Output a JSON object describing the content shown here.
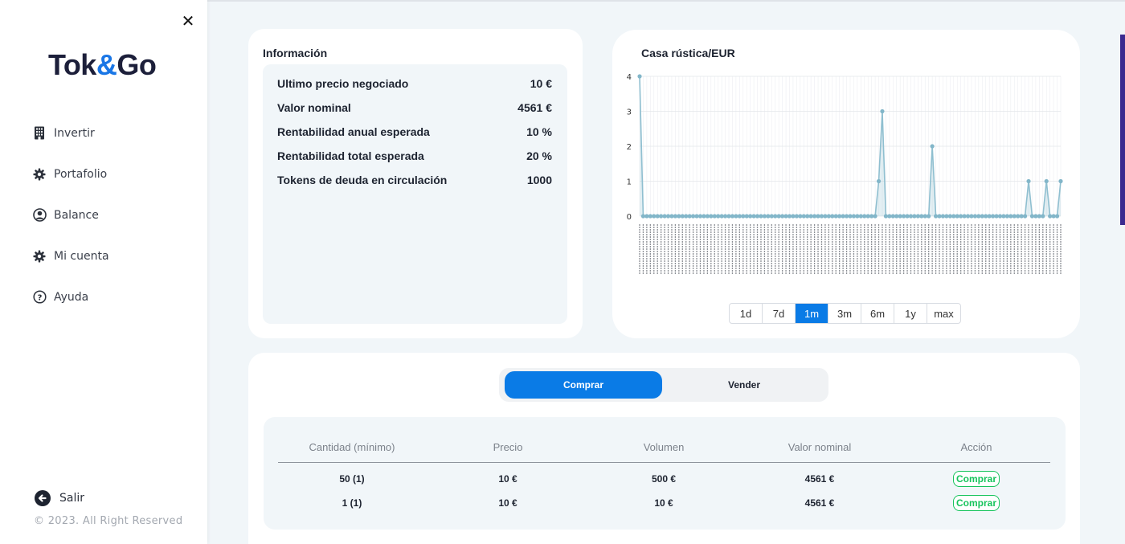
{
  "sidebar": {
    "logo_pre": "Tok",
    "logo_amp": "&",
    "logo_post": "Go",
    "items": [
      {
        "label": "Invertir",
        "icon": "building-icon"
      },
      {
        "label": "Portafolio",
        "icon": "gear-icon"
      },
      {
        "label": "Balance",
        "icon": "user-circle-icon"
      },
      {
        "label": "Mi cuenta",
        "icon": "gear-icon"
      },
      {
        "label": "Ayuda",
        "icon": "help-circle-icon"
      }
    ],
    "logout_label": "Salir",
    "copyright": "© 2023. All Right Reserved"
  },
  "info": {
    "title": "Información",
    "rows": [
      {
        "label": "Ultimo precio negociado",
        "value": "10 €"
      },
      {
        "label": "Valor nominal",
        "value": "4561 €"
      },
      {
        "label": "Rentabilidad anual esperada",
        "value": "10 %"
      },
      {
        "label": "Rentabilidad total esperada",
        "value": "20 %"
      },
      {
        "label": "Tokens de deuda en circulación",
        "value": "1000"
      }
    ]
  },
  "chart": {
    "title": "Casa rústica/EUR",
    "ranges": [
      "1d",
      "7d",
      "1m",
      "3m",
      "6m",
      "1y",
      "max"
    ],
    "active_range": "1m"
  },
  "chart_data": {
    "type": "line",
    "title": "Casa rústica/EUR",
    "ylim": [
      0,
      4
    ],
    "yticks": [
      0,
      1,
      2,
      3,
      4
    ],
    "grid": true,
    "x_count": 120,
    "values": [
      4,
      0,
      0,
      0,
      0,
      0,
      0,
      0,
      0,
      0,
      0,
      0,
      0,
      0,
      0,
      0,
      0,
      0,
      0,
      0,
      0,
      0,
      0,
      0,
      0,
      0,
      0,
      0,
      0,
      0,
      0,
      0,
      0,
      0,
      0,
      0,
      0,
      0,
      0,
      0,
      0,
      0,
      0,
      0,
      0,
      0,
      0,
      0,
      0,
      0,
      0,
      0,
      0,
      0,
      0,
      0,
      0,
      0,
      0,
      0,
      0,
      0,
      0,
      0,
      0,
      0,
      0,
      1,
      3,
      0,
      0,
      0,
      0,
      0,
      0,
      0,
      0,
      0,
      0,
      0,
      0,
      0,
      2,
      0,
      0,
      0,
      0,
      0,
      0,
      0,
      0,
      0,
      0,
      0,
      0,
      0,
      0,
      0,
      0,
      0,
      0,
      0,
      0,
      0,
      0,
      0,
      0,
      0,
      0,
      1,
      0,
      0,
      0,
      0,
      1,
      0,
      0,
      0,
      1
    ]
  },
  "trade": {
    "buy_tab": "Comprar",
    "sell_tab": "Vender",
    "headers": [
      "Cantidad (mínimo)",
      "Precio",
      "Volumen",
      "Valor nominal",
      "Acción"
    ],
    "rows": [
      {
        "cantidad": "50 (1)",
        "precio": "10 €",
        "volumen": "500 €",
        "valor": "4561 €",
        "accion": "Comprar"
      },
      {
        "cantidad": "1 (1)",
        "precio": "10 €",
        "volumen": "10 €",
        "valor": "4561 €",
        "accion": "Comprar"
      }
    ]
  },
  "colors": {
    "accent": "#0a7be6",
    "success": "#17c45c",
    "line": "#8fbfd0"
  }
}
